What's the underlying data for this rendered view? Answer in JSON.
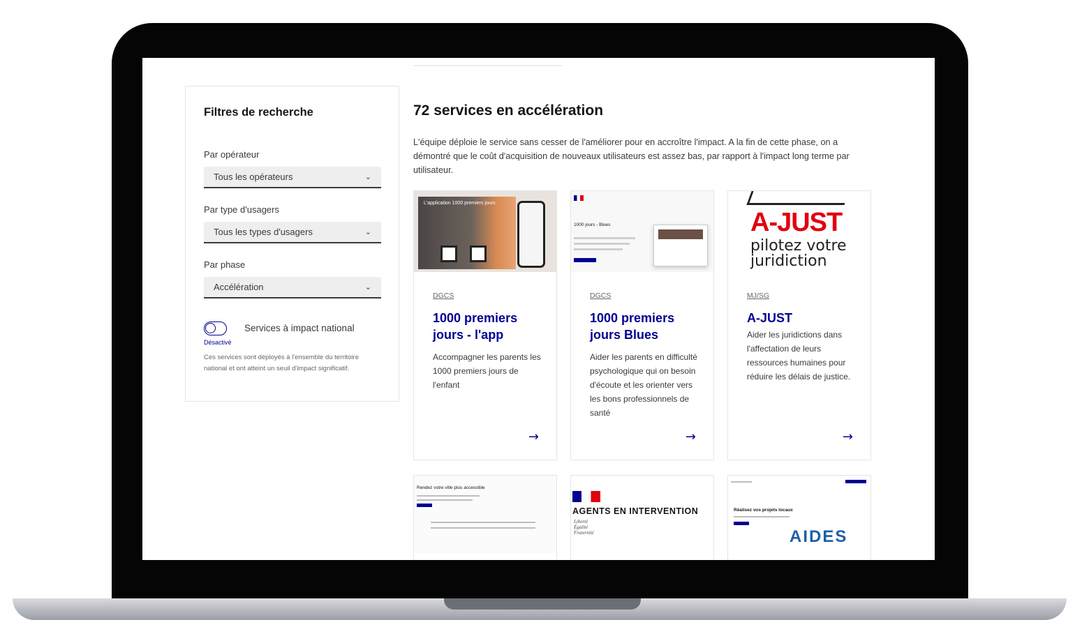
{
  "sidebar": {
    "title": "Filtres de recherche",
    "filters": [
      {
        "label": "Par opérateur",
        "value": "Tous les opérateurs"
      },
      {
        "label": "Par type d'usagers",
        "value": "Tous les types d'usagers"
      },
      {
        "label": "Par phase",
        "value": "Accélération"
      }
    ],
    "toggle": {
      "label": "Services à impact national",
      "state": "Désactivé",
      "help": "Ces services sont déployés à l'ensemble du territoire national et ont atteint un seuil d'impact significatif."
    }
  },
  "main": {
    "title": "72 services en accélération",
    "description": "L'équipe déploie le service sans cesser de l'améliorer pour en accroître l'impact. A la fin de cette phase, on a démontré que le coût d'acquisition de nouveaux utilisateurs est assez bas, par rapport à l'impact long terme par utilisateur.",
    "cards": [
      {
        "operator": "DGCS",
        "title": "1000 premiers jours - l'app",
        "description": "Accompagner les parents les 1000 premiers jours de l'enfant",
        "thumb_text": "L'application 1000 premiers jours"
      },
      {
        "operator": "DGCS",
        "title": "1000 premiers jours Blues",
        "description": "Aider les parents en difficulté psychologique qui on besoin d'écoute et les orienter vers les bons professionnels de santé",
        "thumb_text": "1000 jours - Blues"
      },
      {
        "operator": "MJ/SG",
        "title": "A-JUST",
        "description": "Aider les juridictions dans l'affectation de leurs ressources humaines pour réduire les délais de justice.",
        "logo_title": "A-JUST",
        "logo_subtitle": "pilotez votre juridiction"
      }
    ],
    "row2": [
      {
        "thumb_text": "Rendez votre ville plus accessible"
      },
      {
        "thumb_text": "AGENTS EN INTERVENTION",
        "motto": [
          "Liberté",
          "Égalité",
          "Fraternité"
        ]
      },
      {
        "thumb_text": "Réalisez vos projets locaux",
        "logo": "AIDES"
      }
    ]
  },
  "icons": {
    "arrow": "arrow-right-icon",
    "chevron": "chevron-down-icon"
  },
  "colors": {
    "accent": "#000091",
    "brand_red": "#e1000f"
  }
}
